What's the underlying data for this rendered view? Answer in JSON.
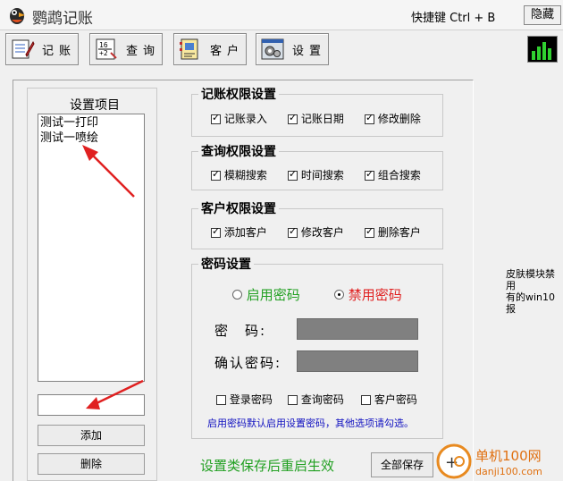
{
  "window": {
    "title": "鹦鹉记账",
    "shortcut_label": "快捷键 Ctrl + B",
    "hide_label": "隐藏"
  },
  "toolbar": {
    "bookkeeping_label": "记账",
    "query_label": "查询",
    "customer_label": "客户",
    "settings_label": "设置"
  },
  "settings_items": {
    "title": "设置项目",
    "items": [
      "测试一打印",
      "测试一喷绘"
    ],
    "input_value": "",
    "add_label": "添加",
    "delete_label": "删除"
  },
  "bookkeeping_perm": {
    "title": "记账权限设置",
    "options": [
      {
        "label": "记账录入",
        "checked": true
      },
      {
        "label": "记账日期",
        "checked": true
      },
      {
        "label": "修改删除",
        "checked": true
      }
    ]
  },
  "query_perm": {
    "title": "查询权限设置",
    "options": [
      {
        "label": "模糊搜索",
        "checked": true
      },
      {
        "label": "时间搜索",
        "checked": true
      },
      {
        "label": "组合搜索",
        "checked": true
      }
    ]
  },
  "customer_perm": {
    "title": "客户权限设置",
    "options": [
      {
        "label": "添加客户",
        "checked": true
      },
      {
        "label": "修改客户",
        "checked": true
      },
      {
        "label": "删除客户",
        "checked": true
      }
    ]
  },
  "password": {
    "title": "密码设置",
    "enable_label": "启用密码",
    "disable_label": "禁用密码",
    "selected": "disable",
    "password_label": "密　码:",
    "confirm_label": "确认密码:",
    "checks": [
      {
        "label": "登录密码",
        "checked": false
      },
      {
        "label": "查询密码",
        "checked": false
      },
      {
        "label": "客户密码",
        "checked": false
      }
    ],
    "hint": "启用密码默认启用设置密码，其他选项请勾选。"
  },
  "side_note": {
    "line1": "皮肤模块禁用",
    "line2": "有的win10报"
  },
  "footer": {
    "restart_note": "设置类保存后重启生效",
    "save_all_label": "全部保存"
  },
  "watermark": {
    "site_name": "单机100网",
    "site_url": "danji100.com"
  },
  "colors": {
    "enable_text": "#22a022",
    "disable_text": "#e02020",
    "restart_note": "#22a022",
    "hint_text": "#1010c0",
    "annotation_arrow": "#e02020"
  }
}
